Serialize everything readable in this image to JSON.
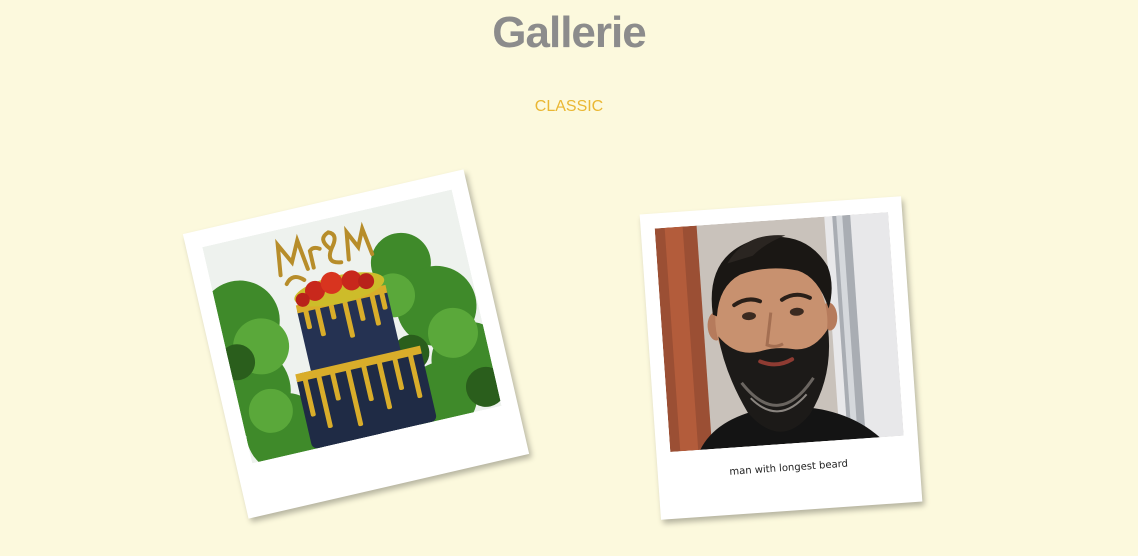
{
  "header": {
    "title": "Gallerie",
    "filter_label": "CLASSIC"
  },
  "gallery": {
    "items": [
      {
        "caption": ""
      },
      {
        "caption": "man with longest beard"
      }
    ]
  },
  "colors": {
    "background": "#fcf9dd",
    "title": "#8c8c8c",
    "accent": "#eab733"
  }
}
